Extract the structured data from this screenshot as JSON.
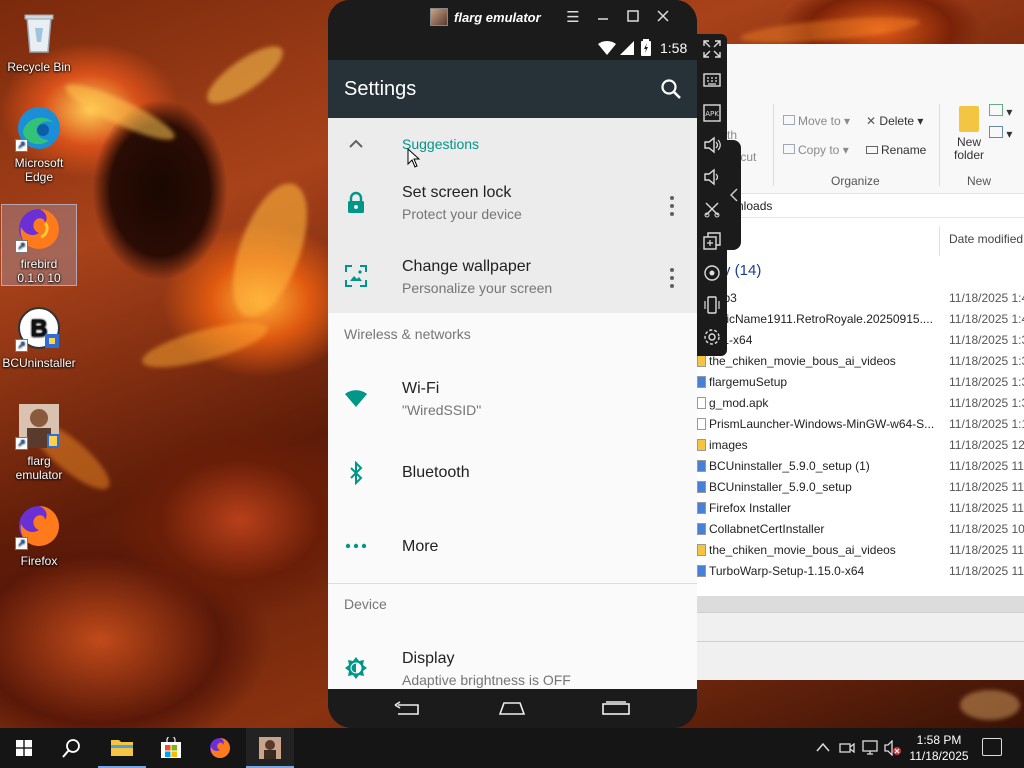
{
  "desktop": {
    "icons": [
      {
        "label": "Recycle Bin",
        "icon": "recycle-bin-icon"
      },
      {
        "label": "Microsoft Edge",
        "icon": "edge-icon"
      },
      {
        "label": "firebird 0.1.0 10",
        "icon": "firefox-icon"
      },
      {
        "label": "BCUninstaller",
        "icon": "bcuninstaller-icon"
      },
      {
        "label": "flarg emulator",
        "icon": "flarg-emulator-icon"
      },
      {
        "label": "Firefox",
        "icon": "firefox-icon"
      }
    ]
  },
  "explorer": {
    "ribbon": {
      "move_to": "Move to",
      "copy_to": "Copy to",
      "delete": "Delete",
      "rename": "Rename",
      "new_folder": "New folder",
      "organize": "Organize",
      "new": "New",
      "frag_path": "th",
      "frag_shortcut": "tcut"
    },
    "address_fragment": "nloads",
    "column_date": "Date modified",
    "group_title": "y (14)",
    "files": [
      {
        "name": "y.sb3",
        "date": "11/18/2025 1:4",
        "type": "file"
      },
      {
        "name": "nericName1911.RetroRoyale.20250915....",
        "date": "11/18/2025 1:4",
        "type": "file"
      },
      {
        "name": "501-x64",
        "date": "11/18/2025 1:3",
        "type": "file"
      },
      {
        "name": "the_chiken_movie_bous_ai_videos",
        "date": "11/18/2025 1:3",
        "type": "folder"
      },
      {
        "name": "flargemuSetup",
        "date": "11/18/2025 1:3",
        "type": "app"
      },
      {
        "name": "g_mod.apk",
        "date": "11/18/2025 1:3",
        "type": "file"
      },
      {
        "name": "PrismLauncher-Windows-MinGW-w64-S...",
        "date": "11/18/2025 1:1",
        "type": "file"
      },
      {
        "name": "images",
        "date": "11/18/2025 12:",
        "type": "folder"
      },
      {
        "name": "BCUninstaller_5.9.0_setup (1)",
        "date": "11/18/2025 11:",
        "type": "app"
      },
      {
        "name": "BCUninstaller_5.9.0_setup",
        "date": "11/18/2025 11:",
        "type": "app"
      },
      {
        "name": "Firefox Installer",
        "date": "11/18/2025 11:",
        "type": "app"
      },
      {
        "name": "CollabnetCertInstaller",
        "date": "11/18/2025 10:",
        "type": "app"
      },
      {
        "name": "the_chiken_movie_bous_ai_videos",
        "date": "11/18/2025 11:",
        "type": "folder"
      },
      {
        "name": "TurboWarp-Setup-1.15.0-x64",
        "date": "11/18/2025 11:",
        "type": "app"
      }
    ]
  },
  "emulator": {
    "window_title": "flarg emulator",
    "status_time": "1:58",
    "appbar_title": "Settings",
    "suggestions_label": "Suggestions",
    "suggestions": [
      {
        "title": "Set screen lock",
        "subtitle": "Protect your device",
        "icon": "lock-icon"
      },
      {
        "title": "Change wallpaper",
        "subtitle": "Personalize your screen",
        "icon": "wallpaper-icon"
      }
    ],
    "sections": [
      {
        "header": "Wireless & networks"
      },
      {
        "header": "Device"
      }
    ],
    "items": {
      "wifi": {
        "title": "Wi-Fi",
        "subtitle": "\"WiredSSID\""
      },
      "bluetooth": {
        "title": "Bluetooth"
      },
      "more": {
        "title": "More"
      },
      "display": {
        "title": "Display",
        "subtitle": "Adaptive brightness is OFF"
      }
    },
    "accent_color": "#009688",
    "appbar_color": "#263238",
    "sidebar_tools": [
      "fullscreen-icon",
      "keyboard-icon",
      "install-apk-icon",
      "volume-up-icon",
      "volume-down-icon",
      "screenshot-icon",
      "multi-instance-icon",
      "location-icon",
      "rotate-icon",
      "settings-icon"
    ]
  },
  "taskbar": {
    "time": "1:58 PM",
    "date": "11/18/2025",
    "apps": [
      "start-icon",
      "search-icon",
      "file-explorer-icon",
      "store-icon",
      "firefox-icon",
      "flarg-emulator-icon"
    ]
  }
}
